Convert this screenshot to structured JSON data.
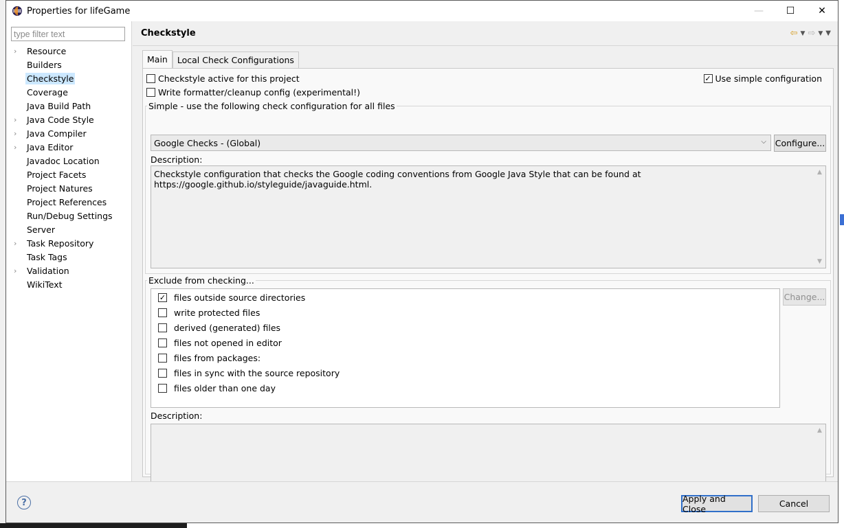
{
  "window": {
    "title": "Properties for lifeGame",
    "controls": {
      "minimize": "—",
      "maximize": "☐",
      "close": "✕"
    }
  },
  "nav": {
    "filter_placeholder": "type filter text",
    "items": [
      {
        "label": "Resource",
        "expandable": true
      },
      {
        "label": "Builders",
        "expandable": false
      },
      {
        "label": "Checkstyle",
        "expandable": false,
        "selected": true
      },
      {
        "label": "Coverage",
        "expandable": false
      },
      {
        "label": "Java Build Path",
        "expandable": false
      },
      {
        "label": "Java Code Style",
        "expandable": true
      },
      {
        "label": "Java Compiler",
        "expandable": true
      },
      {
        "label": "Java Editor",
        "expandable": true
      },
      {
        "label": "Javadoc Location",
        "expandable": false
      },
      {
        "label": "Project Facets",
        "expandable": false
      },
      {
        "label": "Project Natures",
        "expandable": false
      },
      {
        "label": "Project References",
        "expandable": false
      },
      {
        "label": "Run/Debug Settings",
        "expandable": false
      },
      {
        "label": "Server",
        "expandable": false
      },
      {
        "label": "Task Repository",
        "expandable": true
      },
      {
        "label": "Task Tags",
        "expandable": false
      },
      {
        "label": "Validation",
        "expandable": true
      },
      {
        "label": "WikiText",
        "expandable": false
      }
    ]
  },
  "page": {
    "title": "Checkstyle",
    "tabs": [
      {
        "label": "Main",
        "active": true
      },
      {
        "label": "Local Check Configurations",
        "active": false
      }
    ],
    "checkstyle_active": {
      "label": "Checkstyle active for this project",
      "checked": false
    },
    "write_formatter": {
      "label": "Write formatter/cleanup config (experimental!)",
      "checked": false
    },
    "use_simple": {
      "label": "Use simple configuration",
      "checked": true
    },
    "simple_group": {
      "legend": "Simple - use the following check configuration for all files",
      "selected_config": "Google Checks  - (Global)",
      "configure_label": "Configure...",
      "description_label": "Description:",
      "description_text": "Checkstyle configuration that checks the Google coding conventions from Google Java Style that can be found at https://google.github.io/styleguide/javaguide.html."
    },
    "exclude_group": {
      "legend": "Exclude from checking...",
      "change_label": "Change...",
      "items": [
        {
          "label": "files outside source directories",
          "checked": true
        },
        {
          "label": "write protected files",
          "checked": false
        },
        {
          "label": "derived (generated) files",
          "checked": false
        },
        {
          "label": "files not opened in editor",
          "checked": false
        },
        {
          "label": "files from packages:",
          "checked": false
        },
        {
          "label": "files in sync with the source repository",
          "checked": false
        },
        {
          "label": "files older than one day",
          "checked": false
        }
      ],
      "description_label": "Description:",
      "description_text": ""
    }
  },
  "footer": {
    "help_label": "?",
    "apply_close_label": "Apply and Close",
    "cancel_label": "Cancel"
  },
  "colors": {
    "selection": "#cce8ff",
    "primary_border": "#2f6fc9",
    "back_arrow": "#d49b1e"
  },
  "icons": {
    "app": "eclipse-icon",
    "back": "back-arrow-icon",
    "forward": "forward-arrow-icon",
    "menu": "view-menu-icon"
  }
}
